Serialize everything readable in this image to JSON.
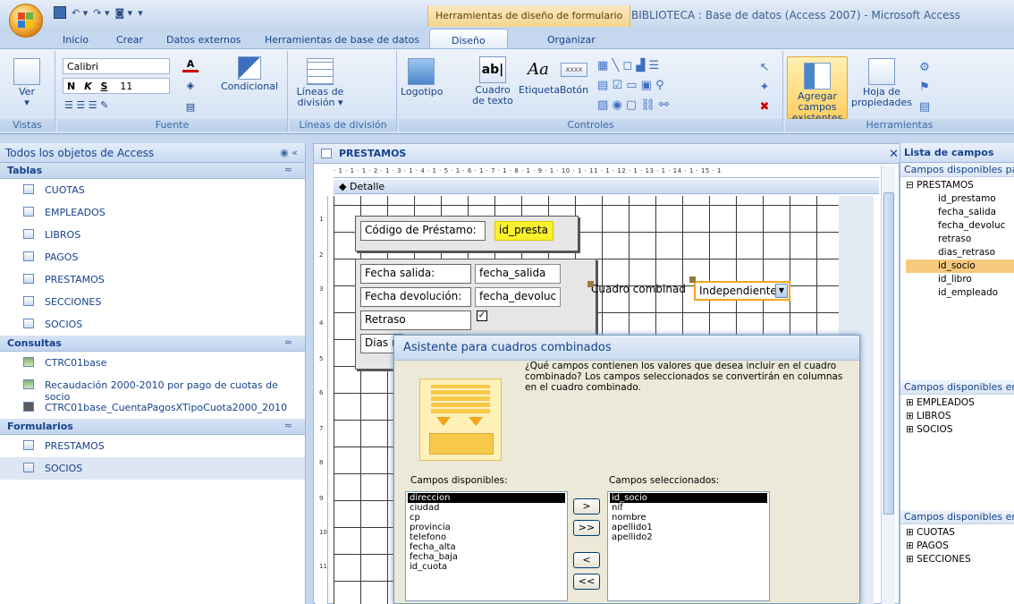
{
  "window": {
    "context_tab": "Herramientas de diseño de formulario",
    "title": "BIBLIOTECA : Base de datos (Access 2007) - Microsoft Access"
  },
  "ribbon_tabs": [
    "Inicio",
    "Crear",
    "Datos externos",
    "Herramientas de base de datos",
    "Diseño",
    "Organizar"
  ],
  "ribbon": {
    "ver_label": "Ver",
    "vistas_label": "Vistas",
    "font_name": "Calibri",
    "font_size": "11",
    "bold": "N",
    "italic": "K",
    "underline": "S",
    "condicional_label": "Condicional",
    "fuente_label": "Fuente",
    "lineas_label": "Líneas de división",
    "lineas_group_label": "Líneas de división",
    "logotipo_label": "Logotipo",
    "cuadro_texto_label": "Cuadro de texto",
    "etiqueta_label": "Etiqueta",
    "boton_label": "Botón",
    "controles_label": "Controles",
    "agregar_label": "Agregar campos existentes",
    "hoja_label": "Hoja de propiedades",
    "herramientas_label": "Herramientas",
    "textbox_glyph": "ab|",
    "label_glyph": "Aa",
    "button_glyph": "xxxx"
  },
  "nav": {
    "title": "Todos los objetos de Access",
    "sections": [
      {
        "name": "Tablas",
        "items": [
          "CUOTAS",
          "EMPLEADOS",
          "LIBROS",
          "PAGOS",
          "PRESTAMOS",
          "SECCIONES",
          "SOCIOS"
        ]
      },
      {
        "name": "Consultas",
        "items": [
          "CTRC01base",
          "Recaudación 2000-2010 por pago de cuotas de socio",
          "CTRC01base_CuentaPagosXTipoCuota2000_2010"
        ]
      },
      {
        "name": "Formularios",
        "items": [
          "PRESTAMOS",
          "SOCIOS"
        ]
      }
    ]
  },
  "design": {
    "doc_tab": "PRESTAMOS",
    "detail_label": "Detalle",
    "ruler_text": "· 1 · 1 · 1 · 2 · 1 · 3 · 1 · 4 · 1 · 5 · 1 · 6 · 1 · 7 · 1 · 8 · 1 · 9 · 1 · 10 · 1 · 11 · 1 · 12 · 1 · 13 · 1 · 14 · 1 · 15 · 1",
    "vruler": [
      "1",
      "2",
      "3",
      "4",
      "5",
      "6",
      "7",
      "8",
      "9",
      "10",
      "11"
    ],
    "codigo_label": "Código de Préstamo:",
    "codigo_value": "id_presta",
    "fecha_salida_label": "Fecha salida:",
    "fecha_salida_value": "fecha_salida",
    "fecha_dev_label": "Fecha devolución:",
    "fecha_dev_value": "fecha_devoluc",
    "retraso_label": "Retraso",
    "dias_label": "Dias re",
    "combo_label": "Cuadro combinad",
    "combo_value": "Independiente"
  },
  "fieldlist": {
    "title": "Lista de campos",
    "sub1": "Campos disponibles pa",
    "table1": "PRESTAMOS",
    "fields": [
      "id_prestamo",
      "fecha_salida",
      "fecha_devoluc",
      "retraso",
      "dias_retraso",
      "id_socio",
      "id_libro",
      "id_empleado"
    ],
    "selected_field": "id_socio",
    "sub2": "Campos disponibles en",
    "tables2": [
      "EMPLEADOS",
      "LIBROS",
      "SOCIOS"
    ],
    "sub3": "Campos disponibles en",
    "tables3": [
      "CUOTAS",
      "PAGOS",
      "SECCIONES"
    ]
  },
  "wizard": {
    "title": "Asistente para cuadros combinados",
    "question": "¿Qué campos contienen los valores que desea incluir en el cuadro combinado? Los campos seleccionados se convertirán en columnas en el cuadro combinado.",
    "available_label": "Campos disponibles:",
    "selected_label": "Campos seleccionados:",
    "available": [
      "direccion",
      "ciudad",
      "cp",
      "provincia",
      "telefono",
      "fecha_alta",
      "fecha_baja",
      "id_cuota"
    ],
    "selected": [
      "id_socio",
      "nif",
      "nombre",
      "apellido1",
      "apellido2"
    ],
    "btn_add": ">",
    "btn_add_all": ">>",
    "btn_remove": "<",
    "btn_remove_all": "<<"
  }
}
